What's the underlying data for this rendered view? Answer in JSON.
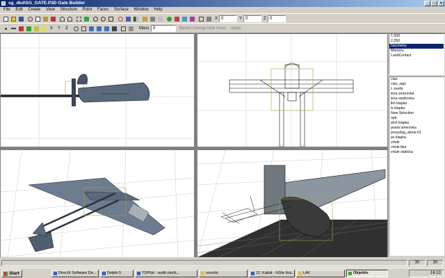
{
  "window": {
    "title": "sg_dkd\\SG_GATE.P3D Gate Builder",
    "min": "_",
    "max": "□",
    "close": "×"
  },
  "menu": [
    "File",
    "Edit",
    "Create",
    "View",
    "Structure",
    "Point",
    "Faces",
    "Surface",
    "Window",
    "Help"
  ],
  "toolbar1": {
    "x_label": "X",
    "x_value": "0",
    "y_label": "Y",
    "y_value": "0",
    "z_label": "Z",
    "z_value": "0"
  },
  "toolbar2": {
    "axis_x": "X",
    "axis_y": "Y",
    "axis_z": "Z",
    "mass_label": "Mass",
    "mass_value": "0",
    "option_label": "Boxed change total mass",
    "apply_label": "apply"
  },
  "lods": {
    "items": [
      "1.500",
      "2.250",
      "Geometry",
      "Memory",
      "LandContact"
    ],
    "selected": 2
  },
  "selections": {
    "items": [
      "clan",
      "clan_sign",
      "L svetlo",
      "leva smerovka",
      "leva vejskovka",
      "lkh klapka",
      "ls klapka",
      "New Selection",
      "opti",
      "plch klapka",
      "prava smerovka",
      "prosy/lag_akme.01",
      "ps klapka",
      "vrtule",
      "vrtule blur",
      "vrtule staticka"
    ]
  },
  "status": {
    "left": "30",
    "right": "30"
  },
  "taskbar": {
    "start": "Start",
    "tasks": [
      "DirectX Software De...",
      "Delphi 5",
      "TOPlist - audit návšt...",
      "sounds",
      "12. Kabát - Kůže líná...",
      "LAV",
      "Objektiv"
    ],
    "clock": "16:13"
  },
  "colors": {
    "titlebar": "#0a246a",
    "selection": "#0a246a",
    "grid": "#c8c8c8",
    "model_dark": "#5a6a7c"
  }
}
